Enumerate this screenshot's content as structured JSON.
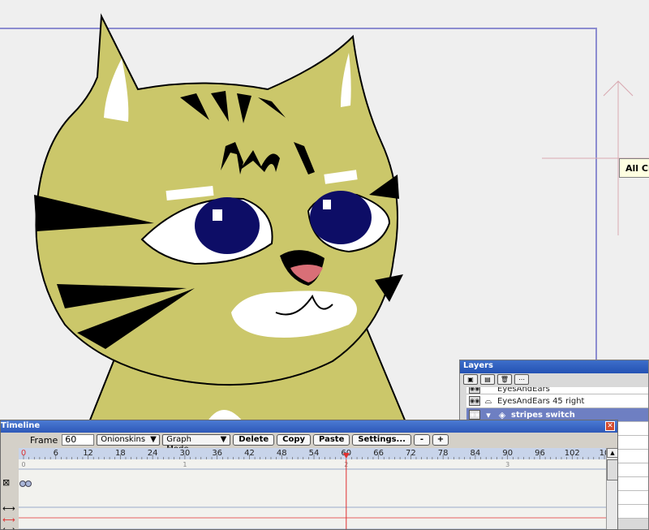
{
  "tooltip": {
    "text": "All Ch"
  },
  "layers": {
    "title": "Layers",
    "tool_icons": [
      "new-layer-icon",
      "add-group-icon",
      "trash-icon",
      "more-icon"
    ],
    "rows": [
      {
        "label": "EyesAndEars",
        "partial": true,
        "selected": false
      },
      {
        "label": "EyesAndEars 45 right",
        "partial": false,
        "selected": false
      },
      {
        "label": "stripes switch",
        "partial": false,
        "selected": true
      }
    ]
  },
  "timeline": {
    "title": "Timeline",
    "frame_label": "Frame",
    "frame_value": "60",
    "onionskins_label": "Onionskins",
    "graph_mode_label": "Graph Mode",
    "delete_label": "Delete",
    "copy_label": "Copy",
    "paste_label": "Paste",
    "settings_label": "Settings...",
    "zoom_out_label": "-",
    "zoom_in_label": "+",
    "ruler_marks": [
      "0",
      "6",
      "12",
      "18",
      "24",
      "30",
      "36",
      "42",
      "48",
      "54",
      "60",
      "66",
      "72",
      "78",
      "84",
      "90",
      "96",
      "102",
      "10"
    ],
    "second_marks": [
      "0",
      "1",
      "2",
      "3"
    ],
    "current_frame": 60,
    "frames_visible": 108
  },
  "colors": {
    "cat_body": "#cbc76a",
    "eye_iris": "#0d0d66",
    "nose": "#d96f77",
    "selection_frame": "#8888cc",
    "playhead": "#e03030"
  }
}
